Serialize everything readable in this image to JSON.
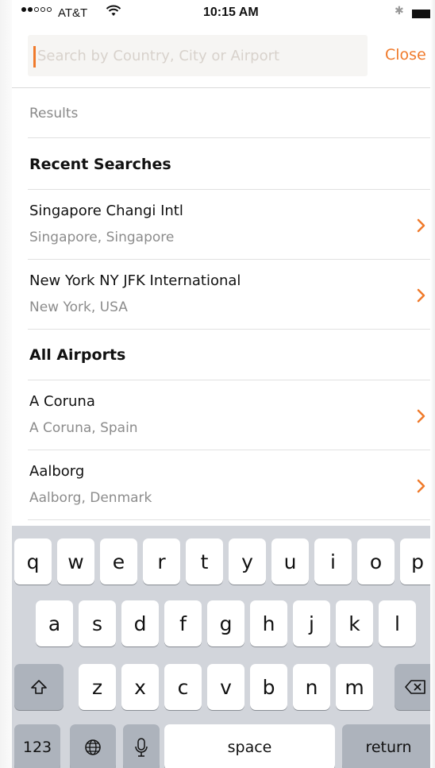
{
  "status_bar": {
    "carrier": "AT&T",
    "time": "10:15 AM"
  },
  "search": {
    "placeholder": "Search by Country, City or Airport",
    "value": "",
    "close_label": "Close"
  },
  "results_label": "Results",
  "recent_searches": {
    "heading": "Recent Searches",
    "items": [
      {
        "title": "Singapore Changi Intl",
        "subtitle": "Singapore, Singapore"
      },
      {
        "title": "New York NY JFK International",
        "subtitle": "New York, USA"
      }
    ]
  },
  "all_airports": {
    "heading": "All Airports",
    "items": [
      {
        "title": "A Coruna",
        "subtitle": "A Coruna, Spain"
      },
      {
        "title": "Aalborg",
        "subtitle": "Aalborg, Denmark"
      }
    ]
  },
  "keyboard": {
    "row1": [
      "q",
      "w",
      "e",
      "r",
      "t",
      "y",
      "u",
      "i",
      "o",
      "p"
    ],
    "row2": [
      "a",
      "s",
      "d",
      "f",
      "g",
      "h",
      "j",
      "k",
      "l"
    ],
    "row3": [
      "z",
      "x",
      "c",
      "v",
      "b",
      "n",
      "m"
    ],
    "numbers_label": "123",
    "space_label": "space",
    "return_label": "return"
  },
  "colors": {
    "accent": "#f07a2b",
    "keyboard_bg": "#d2d5db"
  },
  "icons": [
    "wifi-icon",
    "bluetooth-icon",
    "battery-icon",
    "chevron-right-icon",
    "shift-icon",
    "delete-icon",
    "globe-icon",
    "microphone-icon"
  ]
}
